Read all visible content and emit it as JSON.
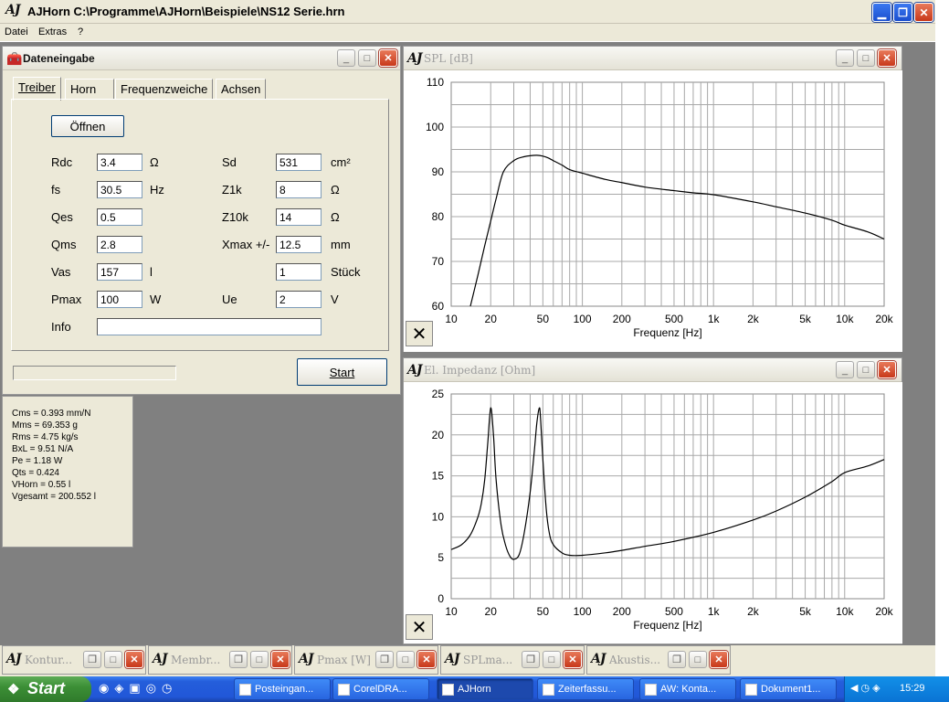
{
  "app": {
    "title": "AJHorn  C:\\Programme\\AJHorn\\Beispiele\\NS12 Serie.hrn",
    "logo": "AJ"
  },
  "menu": [
    "Datei",
    "Extras",
    "?"
  ],
  "input_window": {
    "title": "Dateneingabe",
    "tabs": [
      "Treiber",
      "Horn",
      "Frequenzweiche",
      "Achsen"
    ],
    "open_button": "Öffnen",
    "left": [
      {
        "label": "Rdc",
        "value": "3.4",
        "unit": "Ω"
      },
      {
        "label": "fs",
        "value": "30.5",
        "unit": "Hz"
      },
      {
        "label": "Qes",
        "value": "0.5",
        "unit": ""
      },
      {
        "label": "Qms",
        "value": "2.8",
        "unit": ""
      },
      {
        "label": "Vas",
        "value": "157",
        "unit": "l"
      },
      {
        "label": "Pmax",
        "value": "100",
        "unit": "W"
      },
      {
        "label": "Info",
        "value": "",
        "unit": ""
      }
    ],
    "right": [
      {
        "label": "Sd",
        "value": "531",
        "unit": "cm²"
      },
      {
        "label": "Z1k",
        "value": "8",
        "unit": "Ω"
      },
      {
        "label": "Z10k",
        "value": "14",
        "unit": "Ω"
      },
      {
        "label": "Xmax +/-",
        "value": "12.5",
        "unit": "mm"
      },
      {
        "label": "",
        "value": "1",
        "unit": "Stück"
      },
      {
        "label": "Ue",
        "value": "2",
        "unit": "V"
      }
    ],
    "start_button": "Start",
    "progress": 0
  },
  "results": [
    "Cms = 0.393 mm/N",
    "Mms = 69.353 g",
    "Rms = 4.75 kg/s",
    "BxL = 9.51 N/A",
    "Pe = 1.18 W",
    "Qts = 0.424",
    "VHorn = 0.55 l",
    "Vgesamt = 200.552 l"
  ],
  "chart_data": [
    {
      "type": "line",
      "title": "SPL [dB]",
      "xlabel": "Frequenz [Hz]",
      "ylabel": "",
      "x_scale": "log",
      "xlim": [
        10,
        20000
      ],
      "ylim": [
        60,
        110
      ],
      "yticks": [
        60,
        70,
        80,
        90,
        100,
        110
      ],
      "xticks": [
        "10",
        "20",
        "50",
        "100",
        "200",
        "500",
        "1k",
        "2k",
        "5k",
        "10k",
        "20k"
      ],
      "grid": true,
      "series": [
        {
          "x": [
            14,
            16,
            18,
            20,
            22,
            25,
            30,
            35,
            40,
            45,
            50,
            55,
            60,
            70,
            80,
            100,
            150,
            200,
            300,
            500,
            700,
            1000,
            2000,
            3000,
            5000,
            8000,
            10000,
            15000,
            20000
          ],
          "y": [
            60,
            67,
            73.5,
            79,
            84,
            90,
            92.5,
            93.3,
            93.6,
            93.7,
            93.5,
            93.1,
            92.5,
            91.5,
            90.5,
            89.7,
            88.3,
            87.6,
            86.6,
            85.8,
            85.3,
            84.9,
            83.3,
            82.2,
            80.8,
            79.2,
            78.1,
            76.6,
            75
          ]
        }
      ]
    },
    {
      "type": "line",
      "title": "El. Impedanz [Ohm]",
      "xlabel": "Frequenz [Hz]",
      "ylabel": "",
      "x_scale": "log",
      "xlim": [
        10,
        20000
      ],
      "ylim": [
        0,
        25
      ],
      "yticks": [
        0,
        5,
        10,
        15,
        20,
        25
      ],
      "xticks": [
        "10",
        "20",
        "50",
        "100",
        "200",
        "500",
        "1k",
        "2k",
        "5k",
        "10k",
        "20k"
      ],
      "grid": true,
      "series": [
        {
          "x": [
            10,
            12,
            14,
            16,
            17,
            18,
            19,
            20,
            21,
            22,
            24,
            26,
            28,
            30,
            33,
            36,
            40,
            43,
            45,
            47,
            48,
            50,
            53,
            56,
            60,
            70,
            80,
            100,
            150,
            200,
            300,
            500,
            1000,
            2000,
            3000,
            5000,
            8000,
            10000,
            15000,
            20000
          ],
          "y": [
            6,
            6.6,
            7.8,
            10,
            11.7,
            14.5,
            19,
            23.3,
            20,
            14.5,
            9,
            6.5,
            5.2,
            4.8,
            5.4,
            8,
            13,
            18,
            21.5,
            23.3,
            22,
            17,
            11,
            8,
            6.6,
            5.6,
            5.3,
            5.3,
            5.6,
            5.9,
            6.4,
            7,
            8.1,
            9.6,
            10.7,
            12.4,
            14.3,
            15.4,
            16.2,
            17
          ]
        }
      ]
    }
  ],
  "minimized": [
    {
      "title": "Kontur..."
    },
    {
      "title": "Membr..."
    },
    {
      "title": "Pmax [W]"
    },
    {
      "title": "SPLma..."
    },
    {
      "title": "Akustis..."
    }
  ],
  "taskbar": {
    "start": "Start",
    "items": [
      "Posteingan...",
      "CorelDRA...",
      "AJHorn",
      "Zeiterfassu...",
      "AW: Konta...",
      "Dokument1..."
    ],
    "clock": "15:29"
  }
}
